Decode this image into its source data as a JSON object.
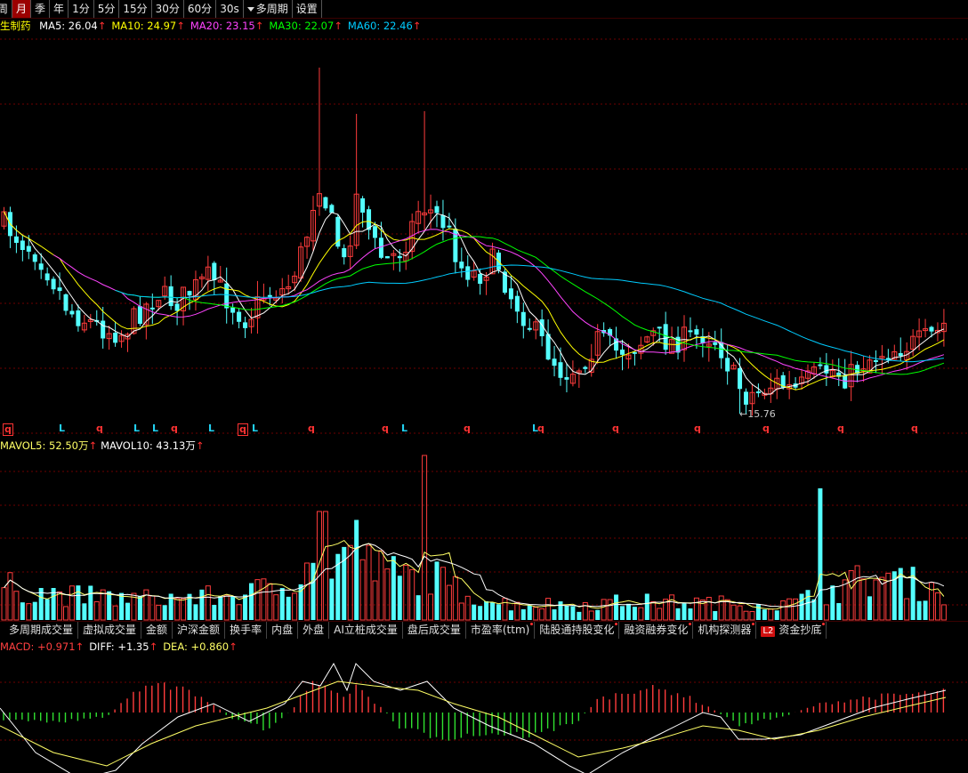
{
  "toolbar": {
    "items": [
      {
        "label": "周",
        "active": false
      },
      {
        "label": "月",
        "active": true
      },
      {
        "label": "季",
        "active": false
      },
      {
        "label": "年",
        "active": false
      },
      {
        "label": "1分",
        "active": false
      },
      {
        "label": "5分",
        "active": false
      },
      {
        "label": "15分",
        "active": false
      },
      {
        "label": "30分",
        "active": false
      },
      {
        "label": "60分",
        "active": false
      },
      {
        "label": "30s",
        "active": false
      }
    ],
    "multi_period": "多周期",
    "settings": "设置"
  },
  "ma_legend": {
    "name": "生制药",
    "items": [
      {
        "text": "MA5: 26.04",
        "arrow": "↑",
        "color": "#ffffff"
      },
      {
        "text": "MA10: 24.97",
        "arrow": "↑",
        "color": "#ffff00"
      },
      {
        "text": "MA20: 23.15",
        "arrow": "↑",
        "color": "#ff44ff"
      },
      {
        "text": "MA30: 22.07",
        "arrow": "↑",
        "color": "#00ff00"
      },
      {
        "text": "MA60: 22.46",
        "arrow": "↑",
        "color": "#00ccff"
      }
    ]
  },
  "price_low_label": "←15.76",
  "signals": [
    {
      "text": "q",
      "type": "q",
      "boxed": true
    },
    {
      "text": "L",
      "type": "l"
    },
    {
      "text": "q",
      "type": "q"
    },
    {
      "text": "L",
      "type": "l"
    },
    {
      "text": "L",
      "type": "l"
    },
    {
      "text": "q",
      "type": "q"
    },
    {
      "text": "L",
      "type": "l"
    },
    {
      "text": "q",
      "type": "q",
      "boxed": true
    },
    {
      "text": "L",
      "type": "l"
    },
    {
      "text": "q",
      "type": "q"
    },
    {
      "text": "q",
      "type": "q"
    },
    {
      "text": "L",
      "type": "l"
    },
    {
      "text": "q",
      "type": "q"
    },
    {
      "text": "L",
      "type": "l"
    },
    {
      "text": "q",
      "type": "q"
    },
    {
      "text": "q",
      "type": "q"
    },
    {
      "text": "q",
      "type": "q"
    },
    {
      "text": "q",
      "type": "q"
    },
    {
      "text": "q",
      "type": "q"
    },
    {
      "text": "q",
      "type": "q"
    }
  ],
  "vol_legend": {
    "items": [
      {
        "text": "MAVOL5: 52.50万",
        "arrow": "↑",
        "color": "#ffff66"
      },
      {
        "text": "MAVOL10: 43.13万",
        "arrow": "↑",
        "color": "#ffffff"
      }
    ]
  },
  "indicator_tabs": [
    {
      "label": "多周期成交量",
      "dot": false,
      "l2": false
    },
    {
      "label": "虚拟成交量",
      "dot": false,
      "l2": false
    },
    {
      "label": "金额",
      "dot": false,
      "l2": false
    },
    {
      "label": "沪深金额",
      "dot": false,
      "l2": false
    },
    {
      "label": "换手率",
      "dot": false,
      "l2": false
    },
    {
      "label": "内盘",
      "dot": false,
      "l2": false
    },
    {
      "label": "外盘",
      "dot": false,
      "l2": false
    },
    {
      "label": "AI立桩成交量",
      "dot": false,
      "l2": false
    },
    {
      "label": "盘后成交量",
      "dot": false,
      "l2": false
    },
    {
      "label": "市盈率(ttm)",
      "dot": true,
      "l2": false
    },
    {
      "label": "陆股通持股变化",
      "dot": true,
      "l2": false
    },
    {
      "label": "融资融券变化",
      "dot": true,
      "l2": false
    },
    {
      "label": "机构探测器",
      "dot": true,
      "l2": false
    },
    {
      "label": "资金抄底",
      "dot": true,
      "l2": true,
      "badge": "L2"
    }
  ],
  "macd_legend": {
    "items": [
      {
        "text": "MACD: +0.971",
        "arrow": "↑",
        "color": "#ff4040"
      },
      {
        "text": "DIFF: +1.35",
        "arrow": "↑",
        "color": "#ffffff"
      },
      {
        "text": "DEA: +0.860",
        "arrow": "↑",
        "color": "#ffff66"
      }
    ]
  },
  "colors": {
    "up": "#ff3c3c",
    "down": "#54ffff",
    "grid": "#6e0000",
    "ma5": "#ffffff",
    "ma10": "#ffff00",
    "ma20": "#ff44ff",
    "ma30": "#00ff00",
    "ma60": "#00ccff"
  }
}
